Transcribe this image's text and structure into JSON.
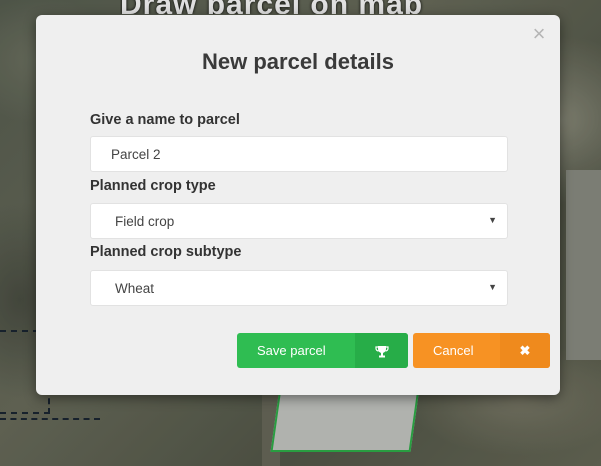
{
  "background": {
    "header_text": "Draw parcel on map"
  },
  "modal": {
    "title": "New parcel details",
    "close_symbol": "×",
    "name_label": "Give a name to parcel",
    "name_value": "Parcel 2",
    "crop_type_label": "Planned crop type",
    "crop_type_value": "Field crop",
    "crop_subtype_label": "Planned crop subtype",
    "crop_subtype_value": "Wheat",
    "save_label": "Save parcel",
    "save_icon": "trophy-icon",
    "cancel_label": "Cancel",
    "cancel_icon": "close-x-icon"
  },
  "colors": {
    "save": "#2fbd52",
    "cancel": "#f79223",
    "parcel_outline": "#2fb34a"
  }
}
